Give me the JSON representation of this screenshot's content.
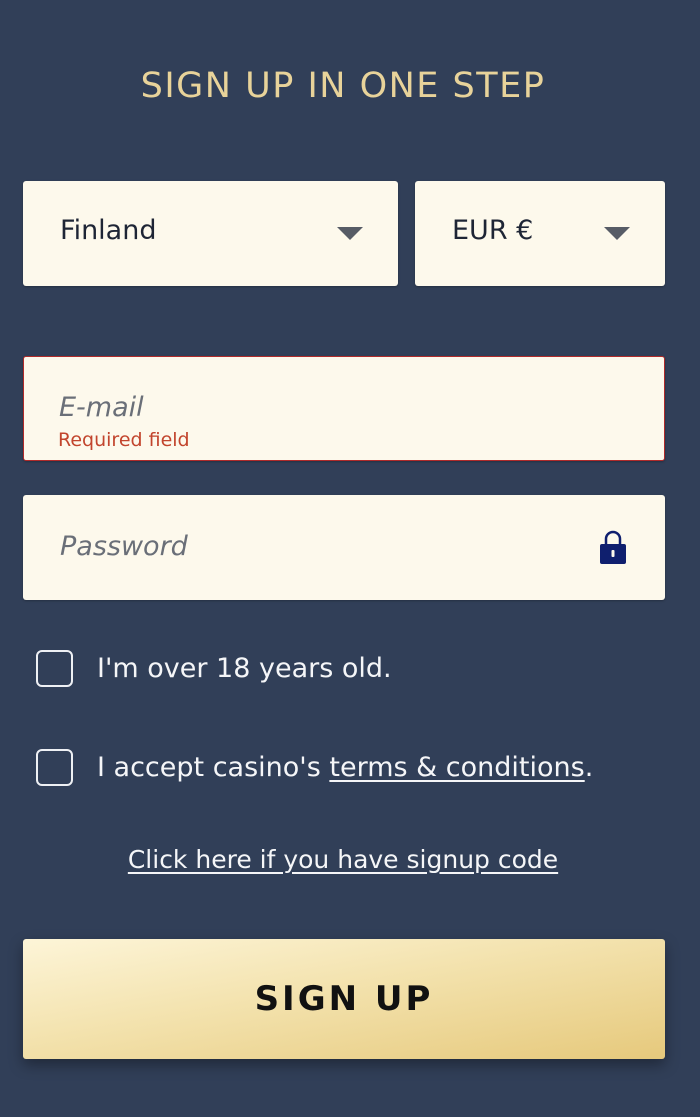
{
  "form": {
    "title": "SIGN UP IN ONE STEP",
    "country": {
      "value": "Finland"
    },
    "currency": {
      "value": "EUR €"
    },
    "email": {
      "placeholder": "E-mail",
      "error": "Required field"
    },
    "password": {
      "placeholder": "Password",
      "icon": "lock-icon"
    },
    "age_checkbox": {
      "label": "I'm over 18 years old.",
      "checked": false
    },
    "terms_checkbox": {
      "label_prefix": "I accept casino's ",
      "link_text": "terms & conditions",
      "label_suffix": ".",
      "checked": false
    },
    "signup_code_link": "Click here if you have signup code",
    "submit_label": "SIGN UP"
  },
  "colors": {
    "background": "#313f58",
    "title": "#e8d39a",
    "field_background": "#fdf9ec",
    "error": "#c2452d",
    "button_gold": "#e6c97c"
  }
}
